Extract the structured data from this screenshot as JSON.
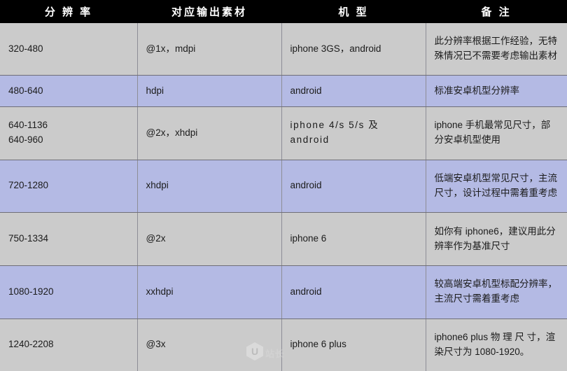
{
  "table": {
    "columns": [
      {
        "key": "resolution",
        "label": "分 辨 率"
      },
      {
        "key": "asset",
        "label": "对应输出素材"
      },
      {
        "key": "model",
        "label": "机 型"
      },
      {
        "key": "remark",
        "label": "备 注"
      }
    ],
    "rows": [
      {
        "tint": "gray",
        "resolution": "320-480",
        "asset": "@1x，mdpi",
        "model": "iphone 3GS，android",
        "remark": "此分辨率根据工作经验，无特殊情况已不需要考虑输出素材"
      },
      {
        "tint": "lavender",
        "resolution": "480-640",
        "asset": "hdpi",
        "model": "android",
        "remark": "标准安卓机型分辨率"
      },
      {
        "tint": "gray",
        "resolution": "640-1136\n640-960",
        "asset": "@2x，xhdpi",
        "model": "iphone 4/s 5/s 及 android",
        "remark": "iphone 手机最常见尺寸，部分安卓机型使用"
      },
      {
        "tint": "lavender",
        "resolution": "720-1280",
        "asset": "xhdpi",
        "model": "android",
        "remark": "低端安卓机型常见尺寸，主流尺寸，设计过程中需着重考虑"
      },
      {
        "tint": "gray",
        "resolution": "750-1334",
        "asset": "@2x",
        "model": "iphone 6",
        "remark": "如你有 iphone6，建议用此分辨率作为基准尺寸"
      },
      {
        "tint": "lavender",
        "resolution": "1080-1920",
        "asset": "xxhdpi",
        "model": "android",
        "remark": "较高端安卓机型标配分辨率，主流尺寸需着重考虑"
      },
      {
        "tint": "gray",
        "resolution": "1240-2208",
        "asset": "@3x",
        "model": "iphone 6 plus",
        "remark": "iphone6 plus 物 理 尺 寸，渲染尺寸为 1080-1920。"
      }
    ]
  },
  "watermark": {
    "mark": "U",
    "text": "站长"
  },
  "colors": {
    "header_background": "#000000",
    "header_text": "#ffffff",
    "row_gray": "#cbcbcb",
    "row_lavender": "#b4bae4",
    "cell_text": "#1b1b1b",
    "grid_line": "#6f6f78"
  }
}
